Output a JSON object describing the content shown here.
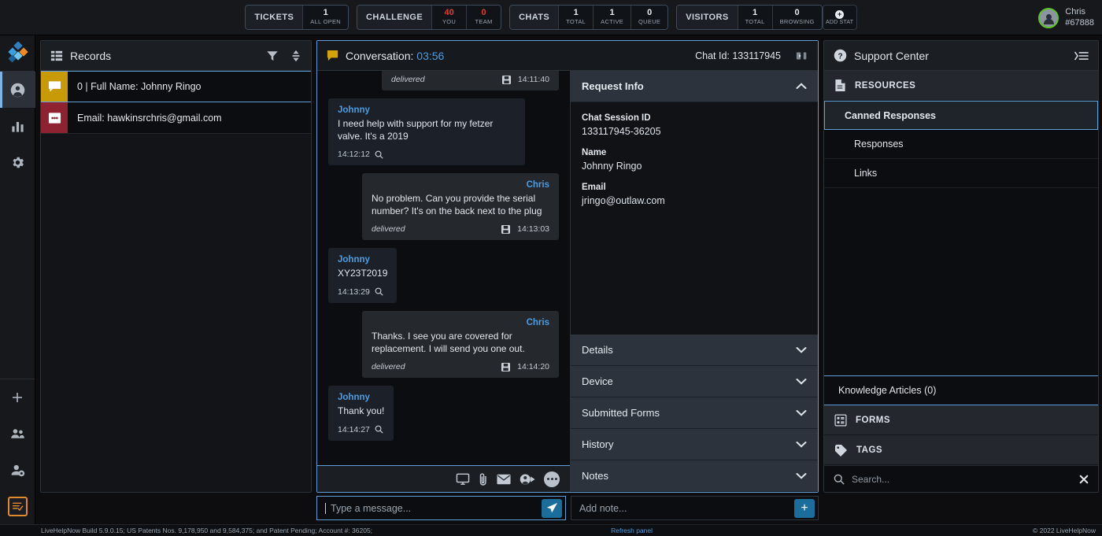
{
  "topbar": {
    "stats": [
      {
        "name": "TICKETS",
        "cells": [
          {
            "num": "1",
            "label": "ALL OPEN",
            "accent": "normal"
          }
        ]
      },
      {
        "name": "CHALLENGE",
        "cells": [
          {
            "num": "40",
            "label": "YOU",
            "accent": "red"
          },
          {
            "num": "0",
            "label": "TEAM",
            "accent": "red"
          }
        ]
      },
      {
        "name": "CHATS",
        "cells": [
          {
            "num": "1",
            "label": "TOTAL",
            "accent": "normal"
          },
          {
            "num": "1",
            "label": "ACTIVE",
            "accent": "normal"
          },
          {
            "num": "0",
            "label": "QUEUE",
            "accent": "normal"
          }
        ]
      },
      {
        "name": "VISITORS",
        "cells": [
          {
            "num": "1",
            "label": "TOTAL",
            "accent": "normal"
          },
          {
            "num": "0",
            "label": "BROWSING",
            "accent": "normal"
          }
        ]
      }
    ],
    "add_stat_label": "ADD STAT",
    "user": {
      "name": "Chris",
      "id": "#67888"
    }
  },
  "rail": {
    "items": [
      {
        "name": "account",
        "icon": "person-icon",
        "active": true
      },
      {
        "name": "reports",
        "icon": "bar-chart-icon",
        "active": false
      },
      {
        "name": "settings",
        "icon": "gear-icon",
        "active": false
      }
    ],
    "bottom_items": [
      {
        "name": "add",
        "icon": "plus-icon"
      },
      {
        "name": "team",
        "icon": "people-icon"
      },
      {
        "name": "agent-settings",
        "icon": "person-gear-icon"
      },
      {
        "name": "forms",
        "icon": "form-checklist-icon"
      }
    ]
  },
  "records": {
    "title": "Records",
    "filter_icon": "filter-icon",
    "sort_icon": "sort-icon",
    "rows": [
      {
        "label": "0 |  Full Name: Johnny Ringo",
        "icon": "chat-bubble-icon",
        "color": "yellow",
        "selected": true
      },
      {
        "label": "Email: hawkinsrchris@gmail.com",
        "icon": "envelope-icon",
        "color": "red",
        "selected": false
      }
    ]
  },
  "conversation": {
    "title": "Conversation:",
    "timer": "03:56",
    "chat_id_label": "Chat Id: 133117945",
    "collapse_icon": "collapse-panel-icon",
    "messages": [
      {
        "author": "",
        "text": "",
        "time": "14:11:40",
        "delivered": "delivered",
        "side": "out",
        "clipped": true
      },
      {
        "author": "Johnny",
        "text": "I need help with support for my fetzer valve. It's a 2019",
        "time": "14:12:12",
        "delivered": "",
        "side": "in",
        "clipped": false
      },
      {
        "author": "Chris",
        "text": "No problem. Can you provide the serial number? It's on the back next to the plug",
        "time": "14:13:03",
        "delivered": "delivered",
        "side": "out",
        "clipped": false
      },
      {
        "author": "Johnny",
        "text": "XY23T2019",
        "time": "14:13:29",
        "delivered": "",
        "side": "in",
        "clipped": false
      },
      {
        "author": "Chris",
        "text": "Thanks. I see you are covered for replacement. I will send you one out.",
        "time": "14:14:20",
        "delivered": "delivered",
        "side": "out",
        "clipped": false
      },
      {
        "author": "Johnny",
        "text": "Thank you!",
        "time": "14:14:27",
        "delivered": "",
        "side": "in",
        "clipped": false
      }
    ],
    "tools": [
      {
        "name": "screen-share-icon"
      },
      {
        "name": "paperclip-icon"
      },
      {
        "name": "envelope-icon"
      },
      {
        "name": "transfer-chat-icon"
      },
      {
        "name": "more-options-icon"
      }
    ],
    "message_input_placeholder": "Type a message...",
    "send_icon": "send-icon"
  },
  "request_info": {
    "title": "Request Info",
    "expanded": true,
    "fields": [
      {
        "key": "Chat Session ID",
        "value": "133117945-36205"
      },
      {
        "key": "Name",
        "value": "Johnny Ringo"
      },
      {
        "key": "Email",
        "value": "jringo@outlaw.com"
      }
    ],
    "sections": [
      {
        "label": "Details"
      },
      {
        "label": "Device"
      },
      {
        "label": "Submitted Forms"
      },
      {
        "label": "History"
      },
      {
        "label": "Notes"
      }
    ],
    "note_placeholder": "Add note...",
    "add_note_icon": "plus-icon"
  },
  "support_center": {
    "title": "Support Center",
    "help_icon": "question-mark-icon",
    "menu_icon": "list-collapse-icon",
    "resources_label": "RESOURCES",
    "resources_icon": "document-icon",
    "items": [
      {
        "label": "Canned Responses",
        "selected": true,
        "sub": false
      },
      {
        "label": "Responses",
        "selected": false,
        "sub": true
      },
      {
        "label": "Links",
        "selected": false,
        "sub": true
      }
    ],
    "knowledge_articles": "Knowledge Articles  (0)",
    "forms_label": "FORMS",
    "forms_icon": "grid-form-icon",
    "tags_label": "TAGS",
    "tags_icon": "tag-icon",
    "search_placeholder": "Search...",
    "search_icon": "search-icon",
    "clear_icon": "close-icon"
  },
  "footer": {
    "left": "LiveHelpNow Build 5.9.0.15; US Patents Nos. 9,178,950 and 9,584,375; and Patent Pending; Account #: 36205;",
    "refresh": "Refresh panel",
    "right": "© 2022 LiveHelpNow"
  },
  "colors": {
    "accent_blue": "#4d9de0",
    "border_blue": "#5f9ed6",
    "alert_red": "#e03b2f",
    "yellow": "#c99a08",
    "dark_red": "#8e2230",
    "green_ring": "#5ec02a",
    "orange": "#e08a2e"
  }
}
